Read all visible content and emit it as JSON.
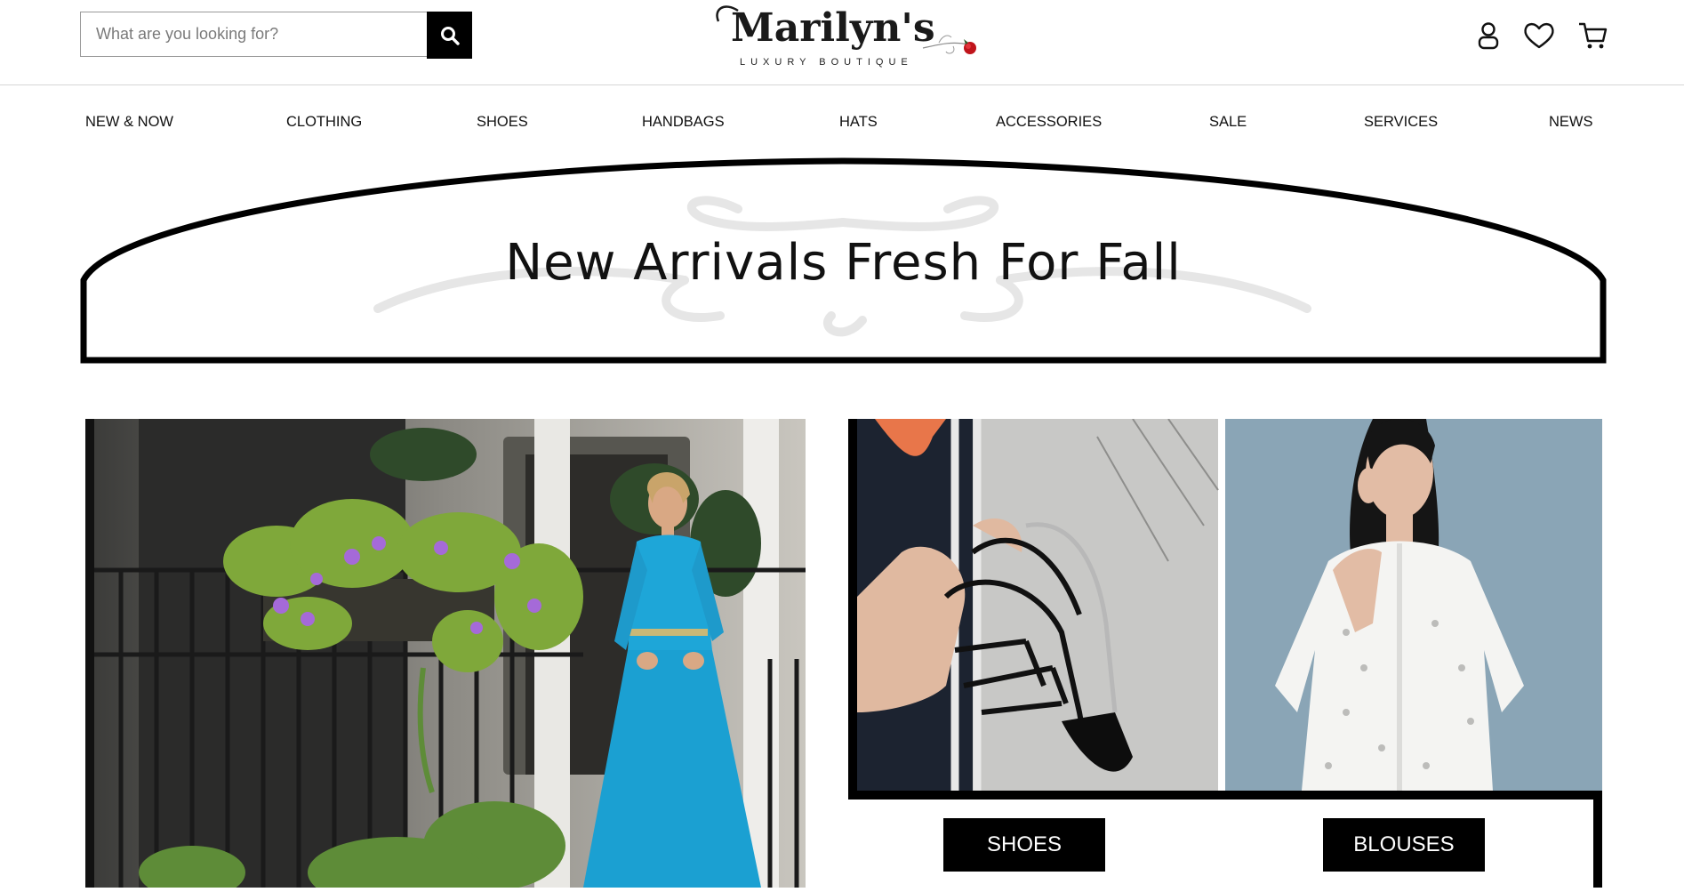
{
  "search": {
    "placeholder": "What are you looking for?"
  },
  "logo": {
    "name": "Marilyn's",
    "tagline": "LUXURY BOUTIQUE"
  },
  "header_icons": [
    "user-icon",
    "heart-icon",
    "cart-icon"
  ],
  "nav": [
    "NEW & NOW",
    "CLOTHING",
    "SHOES",
    "HANDBAGS",
    "HATS",
    "ACCESSORIES",
    "SALE",
    "SERVICES",
    "NEWS"
  ],
  "banner": {
    "title": "New Arrivals Fresh For Fall"
  },
  "categories": {
    "shoes": "SHOES",
    "blouses": "BLOUSES"
  },
  "colors": {
    "accent": "#000000",
    "background": "#ffffff",
    "dress": "#1ea6d8",
    "rose": "#c0141b"
  }
}
